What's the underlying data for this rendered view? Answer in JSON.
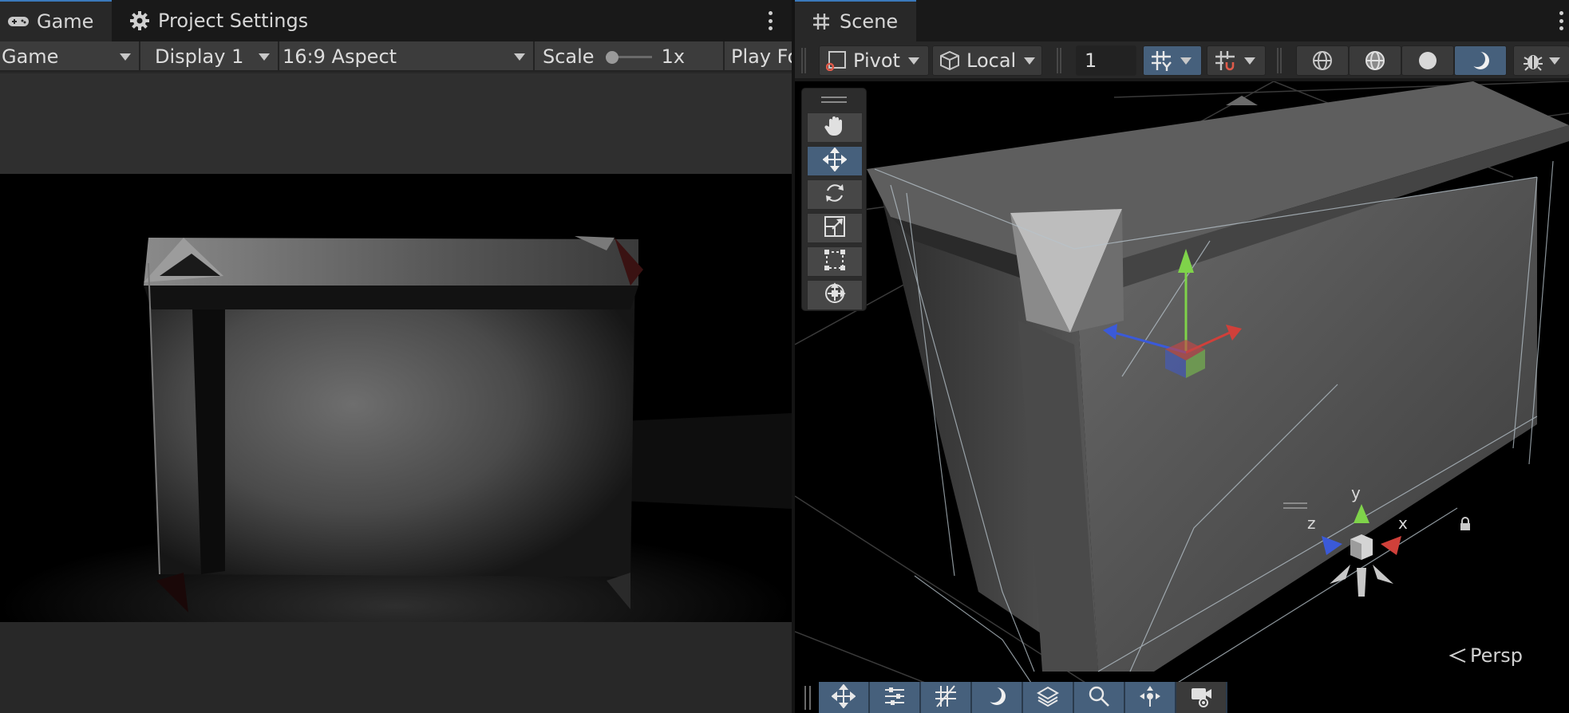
{
  "game_panel": {
    "tabs": [
      {
        "label": "Game",
        "icon": "gamepad-icon",
        "active": true
      },
      {
        "label": "Project Settings",
        "icon": "gear-icon",
        "active": false
      }
    ],
    "toolbar": {
      "view_mode": "Game",
      "display": "Display 1",
      "aspect": "16:9 Aspect",
      "scale_label": "Scale",
      "scale_value": "1x",
      "play_focus": "Play Fo"
    }
  },
  "scene_panel": {
    "tab": {
      "label": "Scene",
      "icon": "hash-icon"
    },
    "toolbar": {
      "pivot": "Pivot",
      "space": "Local",
      "grid_value": "1"
    },
    "tools": [
      "hand-tool",
      "move-tool",
      "rotate-tool",
      "scale-tool",
      "rect-tool",
      "transform-tool"
    ],
    "active_tool": "move-tool",
    "gizmo_axes": {
      "y": "y",
      "x": "x",
      "z": "z"
    },
    "projection": "Persp"
  },
  "colors": {
    "accent": "#3a79bb",
    "active_button": "#46607c",
    "panel_bg": "#282828",
    "toolbar_bg": "#3c3c3c",
    "axis_x": "#d0403a",
    "axis_y": "#7fd34a",
    "axis_z": "#3b5ad8"
  }
}
